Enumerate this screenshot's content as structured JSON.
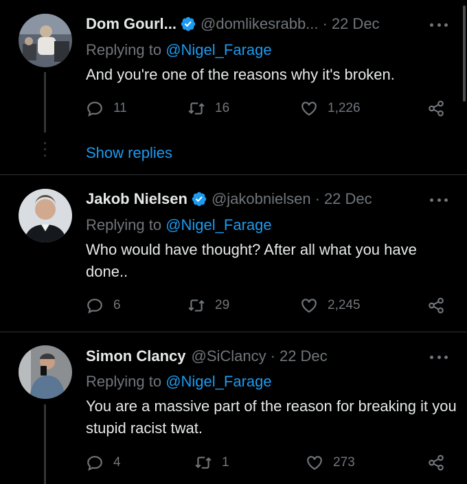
{
  "tweets": [
    {
      "name": "Dom Gourl...",
      "handle": "@domlikesrabb...",
      "date": "22 Dec",
      "reply_prefix": "Replying to ",
      "reply_mention": "@Nigel_Farage",
      "text": "And you're one of the reasons why it's broken.",
      "replies": "11",
      "retweets": "16",
      "likes": "1,226",
      "show_replies": "Show replies"
    },
    {
      "name": "Jakob Nielsen",
      "handle": "@jakobnielsen",
      "date": "22 Dec",
      "reply_prefix": "Replying to ",
      "reply_mention": "@Nigel_Farage",
      "text": "Who would have thought? After all what you have done..",
      "replies": "6",
      "retweets": "29",
      "likes": "2,245"
    },
    {
      "name": "Simon Clancy",
      "handle": "@SiClancy",
      "date": "22 Dec",
      "reply_prefix": "Replying to ",
      "reply_mention": "@Nigel_Farage",
      "text": "You are a massive part of the reason for breaking it you stupid racist twat.",
      "replies": "4",
      "retweets": "1",
      "likes": "273"
    }
  ],
  "separator": "·",
  "colors": {
    "accent": "#1d9bf0",
    "muted": "#71767b",
    "text": "#e7e9ea",
    "background": "#000000"
  }
}
